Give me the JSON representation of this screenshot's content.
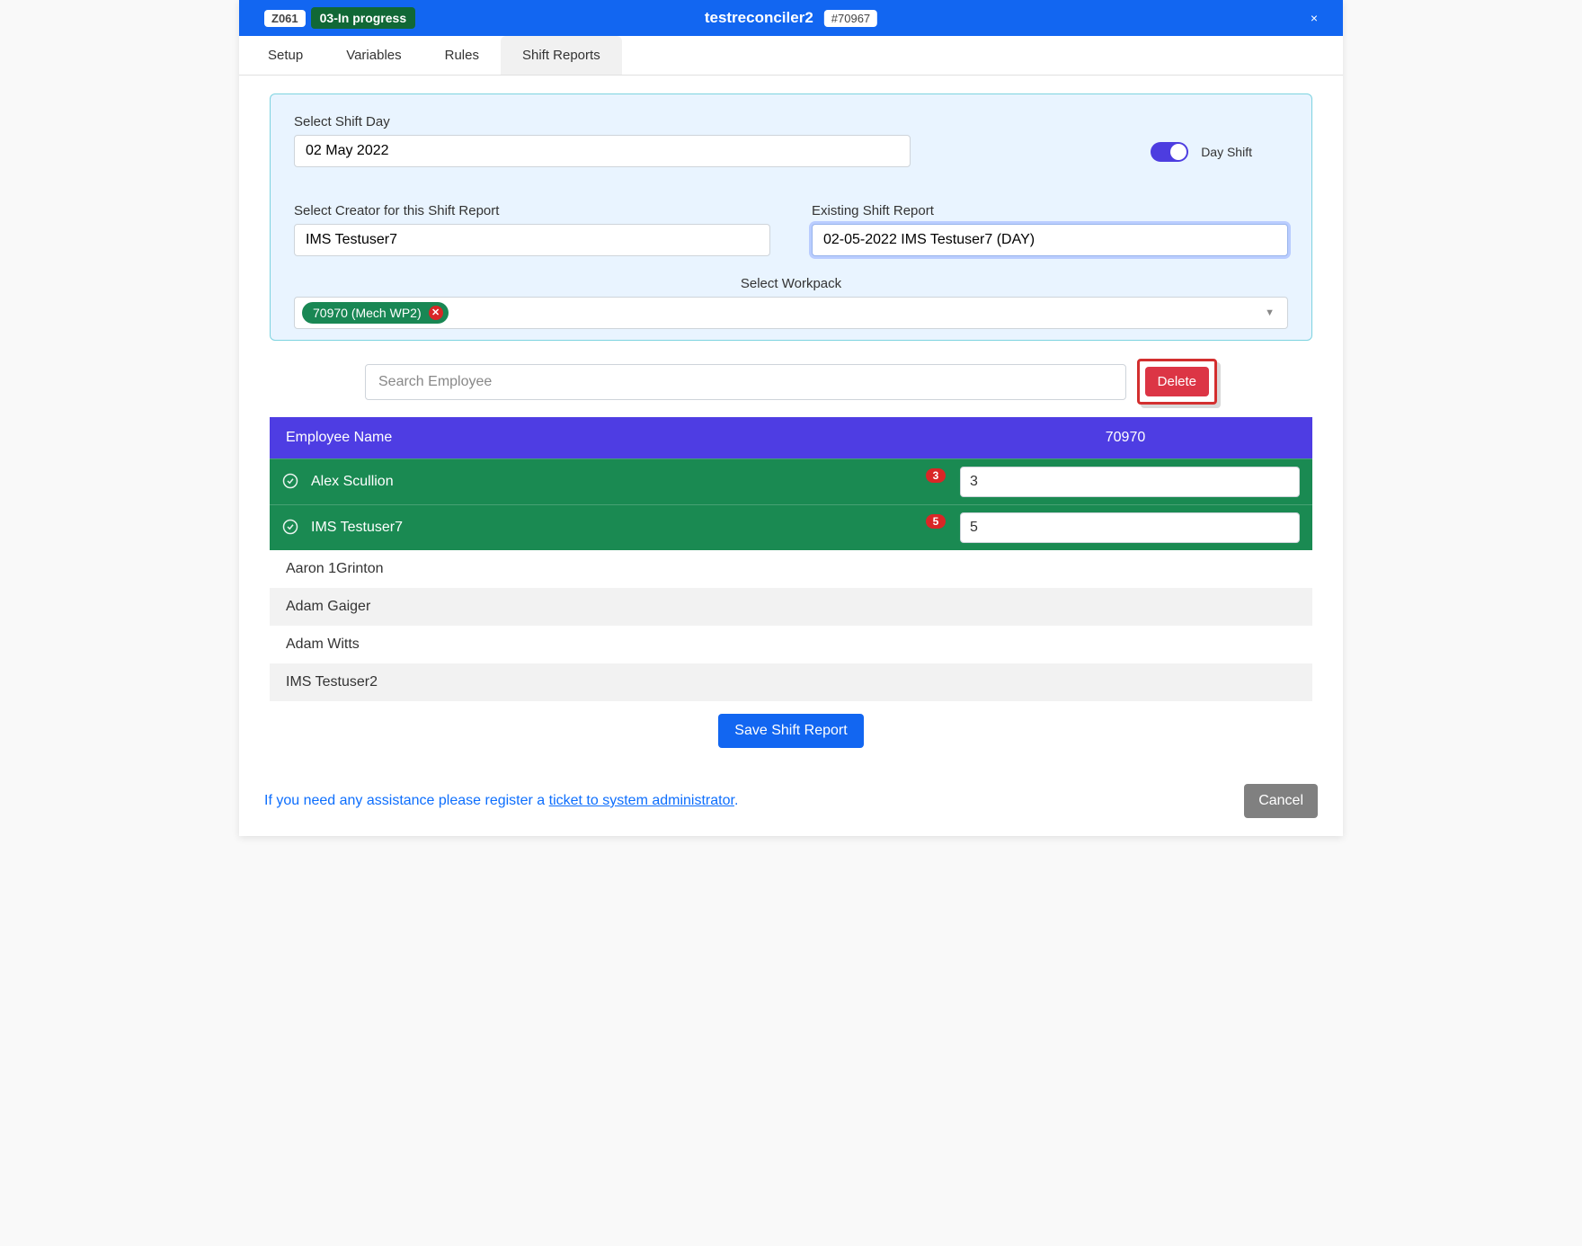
{
  "header": {
    "zone": "Z061",
    "status": "03-In progress",
    "title": "testreconciler2",
    "ticket": "#70967",
    "close": "×"
  },
  "tabs": [
    {
      "label": "Setup"
    },
    {
      "label": "Variables"
    },
    {
      "label": "Rules"
    },
    {
      "label": "Shift Reports"
    }
  ],
  "panel": {
    "shift_day_label": "Select Shift Day",
    "shift_day_value": "02 May 2022",
    "toggle_label": "Day Shift",
    "creator_label": "Select Creator for this Shift Report",
    "creator_value": "IMS Testuser7",
    "existing_label": "Existing Shift Report",
    "existing_value": "02-05-2022 IMS Testuser7 (DAY)",
    "workpack_label": "Select Workpack",
    "workpack_chip": "70970 (Mech WP2)"
  },
  "toolbar": {
    "search_placeholder": "Search Employee",
    "delete_label": "Delete"
  },
  "table": {
    "col_name": "Employee Name",
    "col_num": "70970",
    "selected": [
      {
        "name": "Alex Scullion",
        "badge": "3",
        "value": "3"
      },
      {
        "name": "IMS Testuser7",
        "badge": "5",
        "value": "5"
      }
    ],
    "unselected": [
      {
        "name": "Aaron 1Grinton"
      },
      {
        "name": "Adam Gaiger"
      },
      {
        "name": "Adam Witts"
      },
      {
        "name": "IMS Testuser2"
      }
    ]
  },
  "buttons": {
    "save": "Save Shift Report",
    "cancel": "Cancel"
  },
  "help": {
    "prefix": "If you need any assistance please register a ",
    "link": "ticket to system administrator",
    "suffix": "."
  }
}
